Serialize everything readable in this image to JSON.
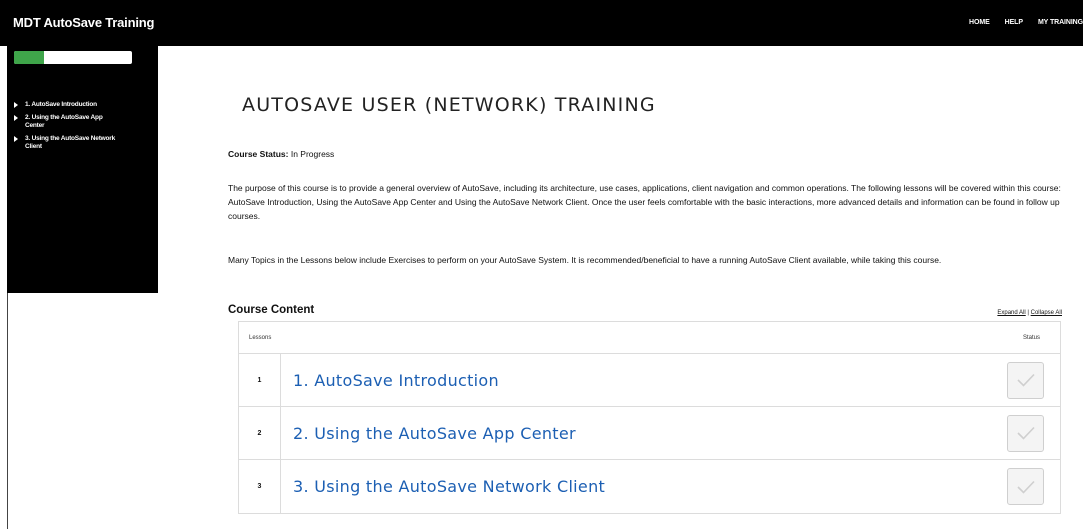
{
  "header": {
    "app_title": "MDT AutoSave Training",
    "nav": [
      "HOME",
      "HELP",
      "MY TRAINING"
    ]
  },
  "sidebar": {
    "progress": 0.25,
    "progress_color": "#3fa54a",
    "items": [
      {
        "label": "1. AutoSave Introduction"
      },
      {
        "label": "2. Using the AutoSave App Center"
      },
      {
        "label": "3. Using the AutoSave Network Client"
      }
    ]
  },
  "main": {
    "title": "AUTOSAVE USER (NETWORK) TRAINING",
    "course_status_label": "Course Status:",
    "course_status_value": "In Progress",
    "paragraph1": "The purpose of this course is to provide a general overview of AutoSave, including its architecture, use cases, applications, client navigation and common operations.  The following lessons will be covered within this course:  AutoSave Introduction, Using the AutoSave App Center and Using the AutoSave Network Client. Once the user feels comfortable with the basic interactions, more advanced details and information can be found in follow up courses.",
    "paragraph2": "Many Topics in the Lessons below include Exercises to perform on your AutoSave System. It is recommended/beneficial to have a running AutoSave Client available, while taking this course.",
    "content_title": "Course Content",
    "expand_all": "Expand All",
    "separator": " | ",
    "collapse_all": "Collapse All",
    "table": {
      "col_lessons": "Lessons",
      "col_status": "Status",
      "rows": [
        {
          "num": "1",
          "title": "1. AutoSave Introduction",
          "status_icon": "checkmark-icon"
        },
        {
          "num": "2",
          "title": "2. Using the AutoSave App Center",
          "status_icon": "checkmark-icon"
        },
        {
          "num": "3",
          "title": "3. Using the AutoSave Network Client",
          "status_icon": "checkmark-icon"
        }
      ]
    }
  }
}
